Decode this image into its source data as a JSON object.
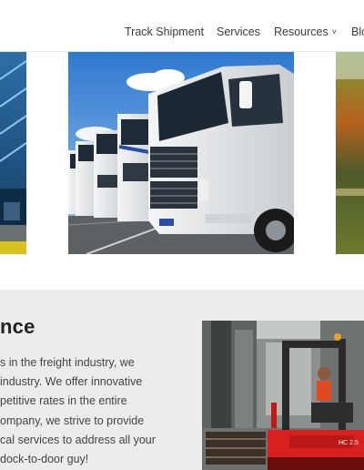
{
  "nav": {
    "items": [
      {
        "label": "Track Shipment"
      },
      {
        "label": "Services"
      },
      {
        "label": "Resources",
        "has_dropdown": true
      },
      {
        "label": "Blo"
      }
    ]
  },
  "section": {
    "heading": "nce",
    "paragraph_lines": [
      "s in the freight industry, we",
      "industry. We offer innovative",
      "petitive rates in the entire",
      "ompany, we strive to provide",
      "cal services to address all your",
      "dock-to-door guy!"
    ]
  },
  "forklift": {
    "badge": "HC 2.5"
  },
  "colors": {
    "nav_text": "#3b3b3b",
    "section_bg": "#ececec",
    "forklift_red": "#d8201e"
  }
}
